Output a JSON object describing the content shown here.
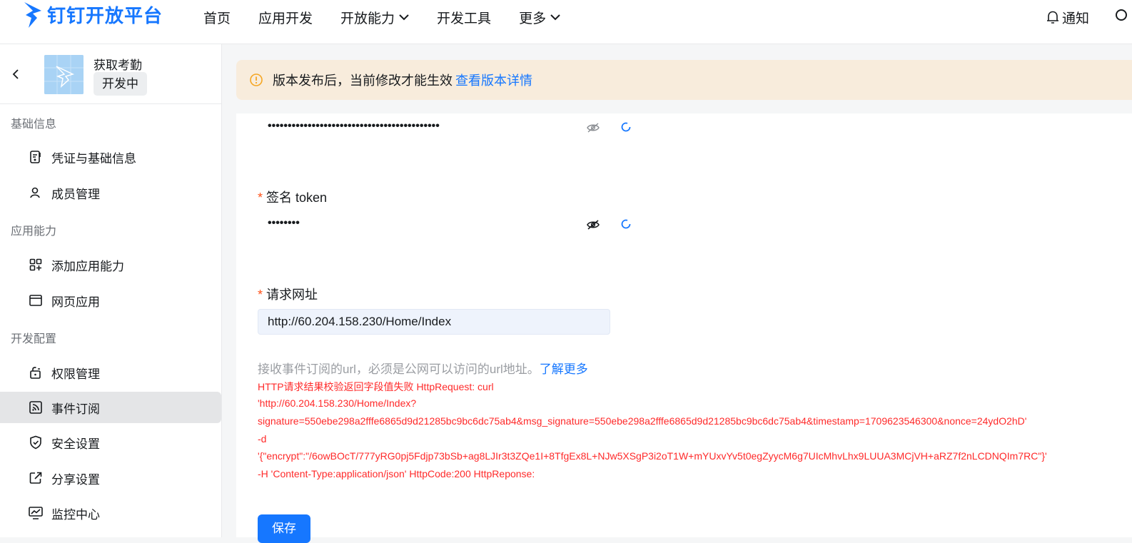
{
  "topbar": {
    "logo_text": "钉钉开放平台",
    "nav": [
      "首页",
      "应用开发",
      "开放能力",
      "开发工具",
      "更多"
    ],
    "notify_label": "通知"
  },
  "sidebar": {
    "app_name": "获取考勤",
    "app_status": "开发中",
    "sections": [
      {
        "title": "基础信息",
        "items": [
          "凭证与基础信息",
          "成员管理"
        ]
      },
      {
        "title": "应用能力",
        "items": [
          "添加应用能力",
          "网页应用"
        ]
      },
      {
        "title": "开发配置",
        "items": [
          "权限管理",
          "事件订阅",
          "安全设置",
          "分享设置",
          "监控中心"
        ]
      }
    ],
    "active_item": "事件订阅"
  },
  "banner": {
    "text": "版本发布后，当前修改才能生效",
    "link": "查看版本详情"
  },
  "form": {
    "aes_key_masked": "•••••••••••••••••••••••••••••••••••••••••••",
    "token_label": "签名 token",
    "token_masked": "••••••••",
    "url_label": "请求网址",
    "url_value": "http://60.204.158.230/Home/Index",
    "help_text": "接收事件订阅的url，必须是公网可以访问的url地址。",
    "help_link": "了解更多",
    "error_lines": [
      "HTTP请求结果校验返回字段值失败 HttpRequest: curl",
      "'http://60.204.158.230/Home/Index?",
      "signature=550ebe298a2fffe6865d9d21285bc9bc6dc75ab4&msg_signature=550ebe298a2fffe6865d9d21285bc9bc6dc75ab4&timestamp=1709623546300&nonce=24ydO2hD'",
      "-d",
      "'{\"encrypt\":\"/6owBOcT/777yRG0pj5Fdjp73bSb+ag8LJIr3t3ZQe1I+8TfgEx8L+NJw5XSgP3i2oT1W+mYUxvYv5t0egZyycM6g7UIcMhvLhx9LUUA3MCjVH+aRZ7f2nLCDNQIm7RC\"}'",
      "-H 'Content-Type:application/json' HttpCode:200 HttpReponse:"
    ],
    "save_label": "保存"
  }
}
